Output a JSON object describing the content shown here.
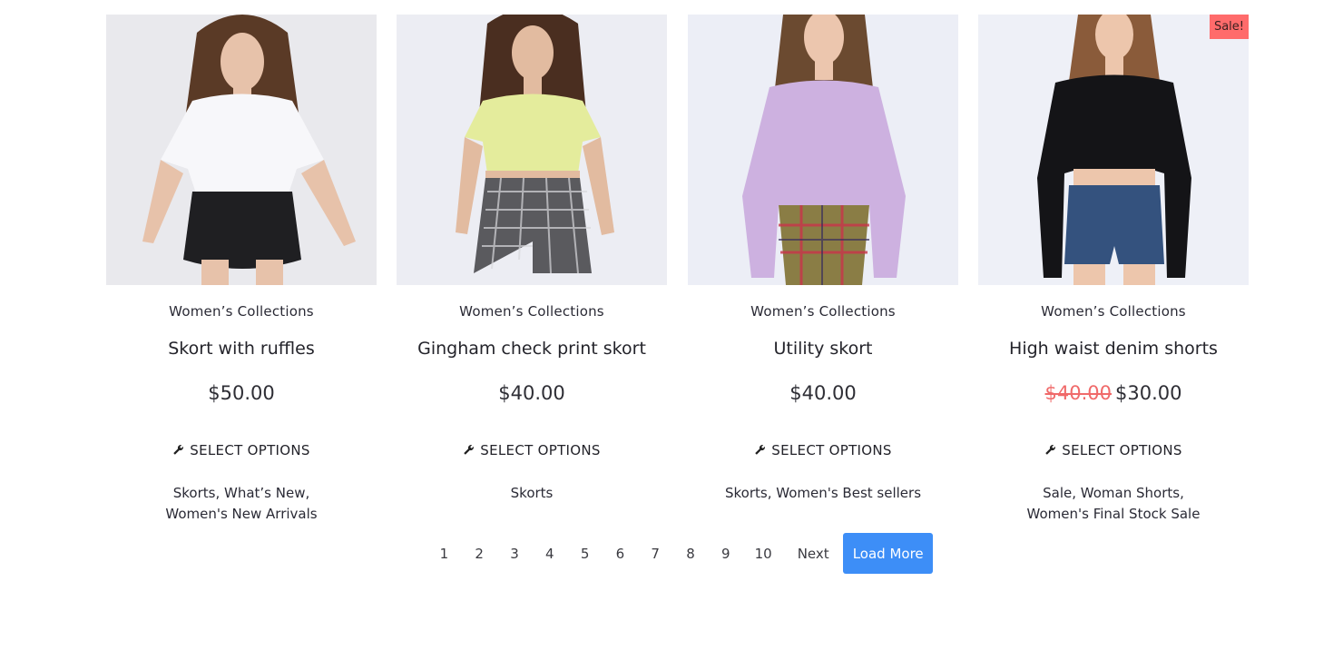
{
  "products": [
    {
      "image_alt": "Skort with ruffles",
      "sale_badge": "",
      "category": "Women’s Collections",
      "title": "Skort with ruffles",
      "price_old": "",
      "price": "$50.00",
      "action_label": "SELECT OPTIONS",
      "tags": [
        "Skorts",
        "What’s New",
        "Women's New Arrivals"
      ],
      "colors": {
        "bg": "#e9e9ed",
        "top": "#f7f7fa",
        "bottom": "#1f1f22",
        "hair": "#5a3a26",
        "skin": "#e7c2aa"
      }
    },
    {
      "image_alt": "Gingham check print skort",
      "sale_badge": "",
      "category": "Women’s Collections",
      "title": "Gingham check print skort",
      "price_old": "",
      "price": "$40.00",
      "action_label": "SELECT OPTIONS",
      "tags": [
        "Skorts"
      ],
      "colors": {
        "bg": "#ecedf3",
        "top": "#e4ec9c",
        "bottom": "#5a5a5e",
        "hair": "#4a2e20",
        "skin": "#e2bba0"
      }
    },
    {
      "image_alt": "Utility skort",
      "sale_badge": "",
      "category": "Women’s Collections",
      "title": "Utility skort",
      "price_old": "",
      "price": "$40.00",
      "action_label": "SELECT OPTIONS",
      "tags": [
        "Skorts",
        "Women's Best sellers"
      ],
      "colors": {
        "bg": "#eceef6",
        "top": "#cdb1e0",
        "bottom": "#8a7d45",
        "hair": "#6b4a30",
        "skin": "#ecc6ae"
      }
    },
    {
      "image_alt": "High waist denim shorts",
      "sale_badge": "Sale!",
      "category": "Women’s Collections",
      "title": "High waist denim shorts",
      "price_old": "$40.00",
      "price": "$30.00",
      "action_label": "SELECT OPTIONS",
      "tags": [
        "Sale",
        "Woman Shorts",
        "Women's Final Stock Sale"
      ],
      "colors": {
        "bg": "#eef0f7",
        "top": "#141417",
        "bottom": "#34527e",
        "hair": "#8a5b3a",
        "skin": "#edc6ac"
      }
    }
  ],
  "pagination": {
    "pages": [
      "1",
      "2",
      "3",
      "4",
      "5",
      "6",
      "7",
      "8",
      "9",
      "10"
    ],
    "next_label": "Next",
    "load_more_label": "Load More"
  },
  "colors": {
    "accent": "#3d8ef7",
    "sale_badge": "#ff6b6b",
    "old_price": "#f06a6a"
  }
}
